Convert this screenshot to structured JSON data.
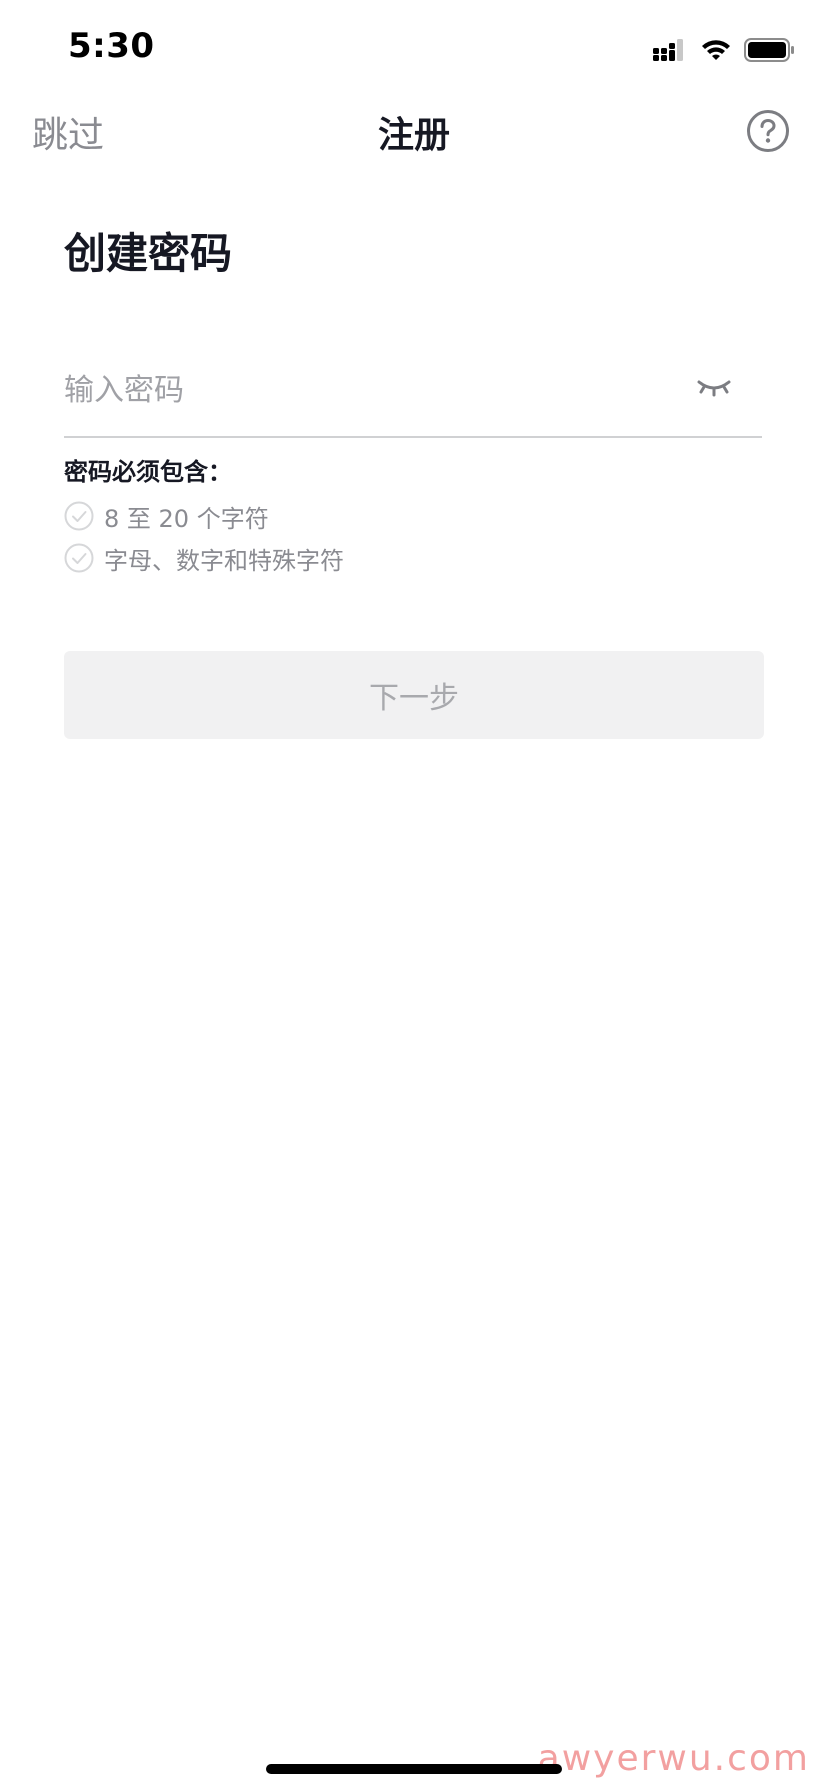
{
  "status_bar": {
    "time": "5:30",
    "icons": [
      "signal-icon",
      "wifi-icon",
      "battery-icon"
    ]
  },
  "nav": {
    "skip_label": "跳过",
    "title": "注册",
    "help_icon": "help-icon"
  },
  "heading": "创建密码",
  "password": {
    "placeholder": "输入密码",
    "value": "",
    "toggle_icon": "eye-closed-icon"
  },
  "requirements": {
    "title": "密码必须包含：",
    "items": [
      {
        "label": "8 至 20 个字符",
        "met": false
      },
      {
        "label": "字母、数字和特殊字符",
        "met": false
      }
    ]
  },
  "next_button": {
    "label": "下一步",
    "enabled": false
  },
  "watermark": "awyerwu.com",
  "colors": {
    "text_primary": "#161823",
    "text_secondary": "#8a8b91",
    "button_disabled_bg": "#f1f1f2",
    "watermark": "#f2a0a0"
  }
}
